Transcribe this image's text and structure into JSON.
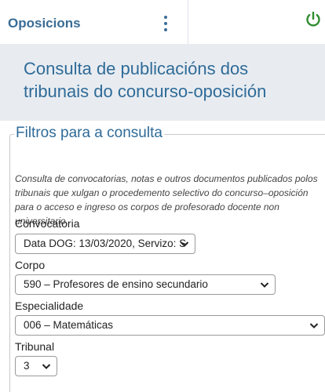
{
  "header": {
    "app_title": "Oposicions",
    "menu_icon": "more-vert-icon",
    "power_icon": "power-icon",
    "accent_color": "#3a6d96",
    "power_color": "#2e8b2e"
  },
  "banner": {
    "title": "Consulta de publicacións dos tribunais do concurso-oposición"
  },
  "filters": {
    "legend": "Filtros para a consulta",
    "intro": "Consulta de convocatorias, notas e outros documentos publicados polos tribunais que xulgan o procedemento selectivo do concurso–oposición para o acceso e ingreso os corpos de profesorado docente non universitario.",
    "convocatoria": {
      "label": "Convocatoria",
      "value": "Data DOG: 13/03/2020, Servizo: S"
    },
    "corpo": {
      "label": "Corpo",
      "value": "590 – Profesores de ensino secundario"
    },
    "especialidade": {
      "label": "Especialidade",
      "value": "006 – Matemáticas"
    },
    "tribunal": {
      "label": "Tribunal",
      "value": "3"
    }
  }
}
